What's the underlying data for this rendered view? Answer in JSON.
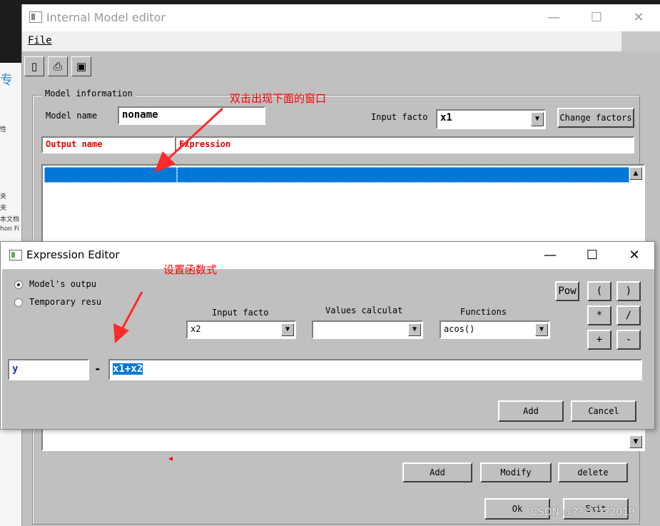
{
  "main_window": {
    "title": "Internal Model editor",
    "controls": {
      "minimize": "—",
      "maximize": "☐",
      "close": "✕"
    },
    "menu": {
      "file": "File"
    },
    "toolbar": {
      "new_icon": "▯",
      "print_icon": "⎙",
      "save_icon": "▣"
    },
    "group_label": "Model information",
    "model_name_label": "Model name",
    "model_name_value": "noname",
    "input_factor_label": "Input facto",
    "input_factor_value": "x1",
    "change_factors_button": "Change factors",
    "columns": {
      "output_name": "Output name",
      "expression": "Expression"
    },
    "add_button": "Add",
    "modify_button": "Modify",
    "delete_button": "delete",
    "ok_button": "Ok",
    "exit_button": "Exit"
  },
  "annotations": {
    "double_click_note": "双击出现下面的窗口",
    "set_function_note": "设置函数式",
    "small_marker": "◂"
  },
  "expression_editor": {
    "title": "Expression Editor",
    "controls": {
      "minimize": "—",
      "maximize": "☐",
      "close": "✕"
    },
    "radio_model_output": "Model's outpu",
    "radio_temporary": "Temporary resu",
    "input_factor_label": "Input facto",
    "input_factor_value": "x2",
    "values_calc_label": "Values calculat",
    "values_calc_value": "",
    "functions_label": "Functions",
    "functions_value": "acos()",
    "pow_button": "Pow",
    "op_buttons": [
      "(",
      ")",
      "*",
      "/",
      "+",
      "-"
    ],
    "output_variable": "y",
    "equals_sign": "-",
    "expression_value": "x1+x2",
    "add_button": "Add",
    "cancel_button": "Cancel"
  },
  "background": {
    "side_texts": [
      "专",
      "性",
      "夹",
      "夹",
      "本文档",
      "hon Fi"
    ]
  },
  "watermark": "CSDN @???????2019",
  "colors": {
    "selection": "#0078d7",
    "header_text": "#ee0000",
    "annotation": "#ff0000"
  }
}
